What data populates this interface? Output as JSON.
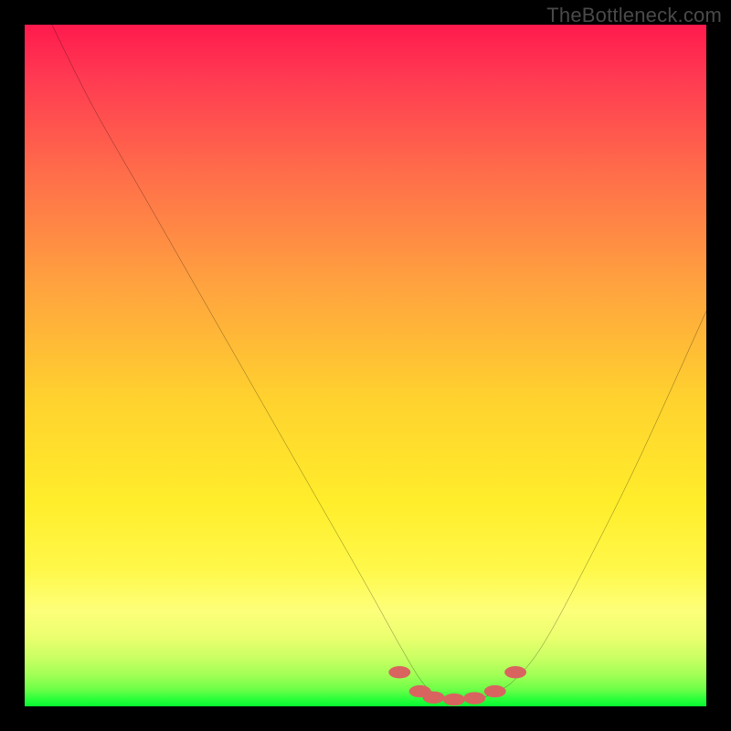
{
  "watermark": "TheBottleneck.com",
  "chart_data": {
    "type": "line",
    "title": "",
    "xlabel": "",
    "ylabel": "",
    "xlim": [
      0,
      100
    ],
    "ylim": [
      0,
      100
    ],
    "series": [
      {
        "name": "bottleneck-curve",
        "x": [
          4,
          10,
          18,
          26,
          34,
          42,
          50,
          55,
          58,
          60,
          63,
          66,
          69,
          72,
          76,
          82,
          90,
          100
        ],
        "values": [
          100,
          88,
          74,
          60,
          46,
          32,
          18,
          9,
          4,
          2,
          1,
          1,
          2,
          4,
          9,
          20,
          36,
          58
        ]
      }
    ],
    "marker_band": {
      "name": "optimal-range",
      "color": "#d9645f",
      "x": [
        55,
        58,
        60,
        63,
        66,
        69,
        72
      ],
      "values": [
        5,
        2.2,
        1.3,
        1,
        1.2,
        2.2,
        5
      ],
      "pill_rx": 1.6,
      "pill_ry": 0.9
    },
    "colors": {
      "curve": "#000000",
      "marker": "#d9645f",
      "background_top": "#ff1a4d",
      "background_bottom": "#08f731"
    }
  }
}
